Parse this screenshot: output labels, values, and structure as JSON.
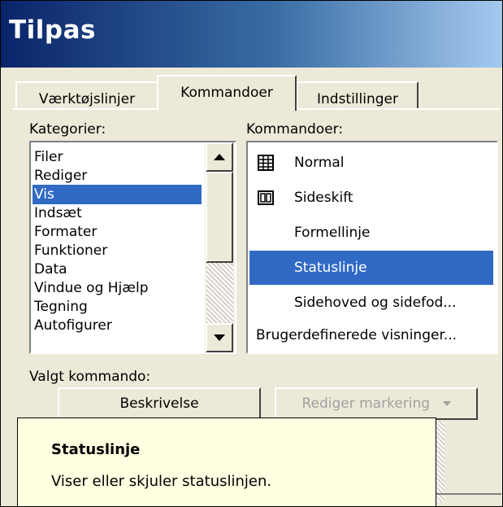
{
  "dialog": {
    "title": "Tilpas"
  },
  "tabs": [
    {
      "label": "Værktøjslinjer",
      "active": false
    },
    {
      "label": "Kommandoer",
      "active": true
    },
    {
      "label": "Indstillinger",
      "active": false
    }
  ],
  "categories": {
    "label": "Kategorier:",
    "items": [
      "Filer",
      "Rediger",
      "Vis",
      "Indsæt",
      "Formater",
      "Funktioner",
      "Data",
      "Vindue og Hjælp",
      "Tegning",
      "Autofigurer"
    ],
    "selected": "Vis"
  },
  "commands": {
    "label": "Kommandoer:",
    "items": [
      {
        "label": "Normal",
        "icon": "grid-icon"
      },
      {
        "label": "Sideskift",
        "icon": "page-break-icon"
      },
      {
        "label": "Formellinje",
        "icon": ""
      },
      {
        "label": "Statuslinje",
        "icon": ""
      },
      {
        "label": "Sidehoved og sidefod...",
        "icon": ""
      },
      {
        "label": "Brugerdefinerede visninger...",
        "icon": ""
      }
    ],
    "selected": "Statuslinje"
  },
  "selected_command": {
    "label": "Valgt kommando:",
    "describe_button": "Beskrivelse",
    "modify_button": "Rediger markering"
  },
  "tooltip": {
    "title": "Statuslinje",
    "description": "Viser eller skjuler statuslinjen."
  },
  "colors": {
    "selection": "#316ac5",
    "tooltip_bg": "#ffffe1",
    "dialog_bg": "#ece9d8"
  }
}
